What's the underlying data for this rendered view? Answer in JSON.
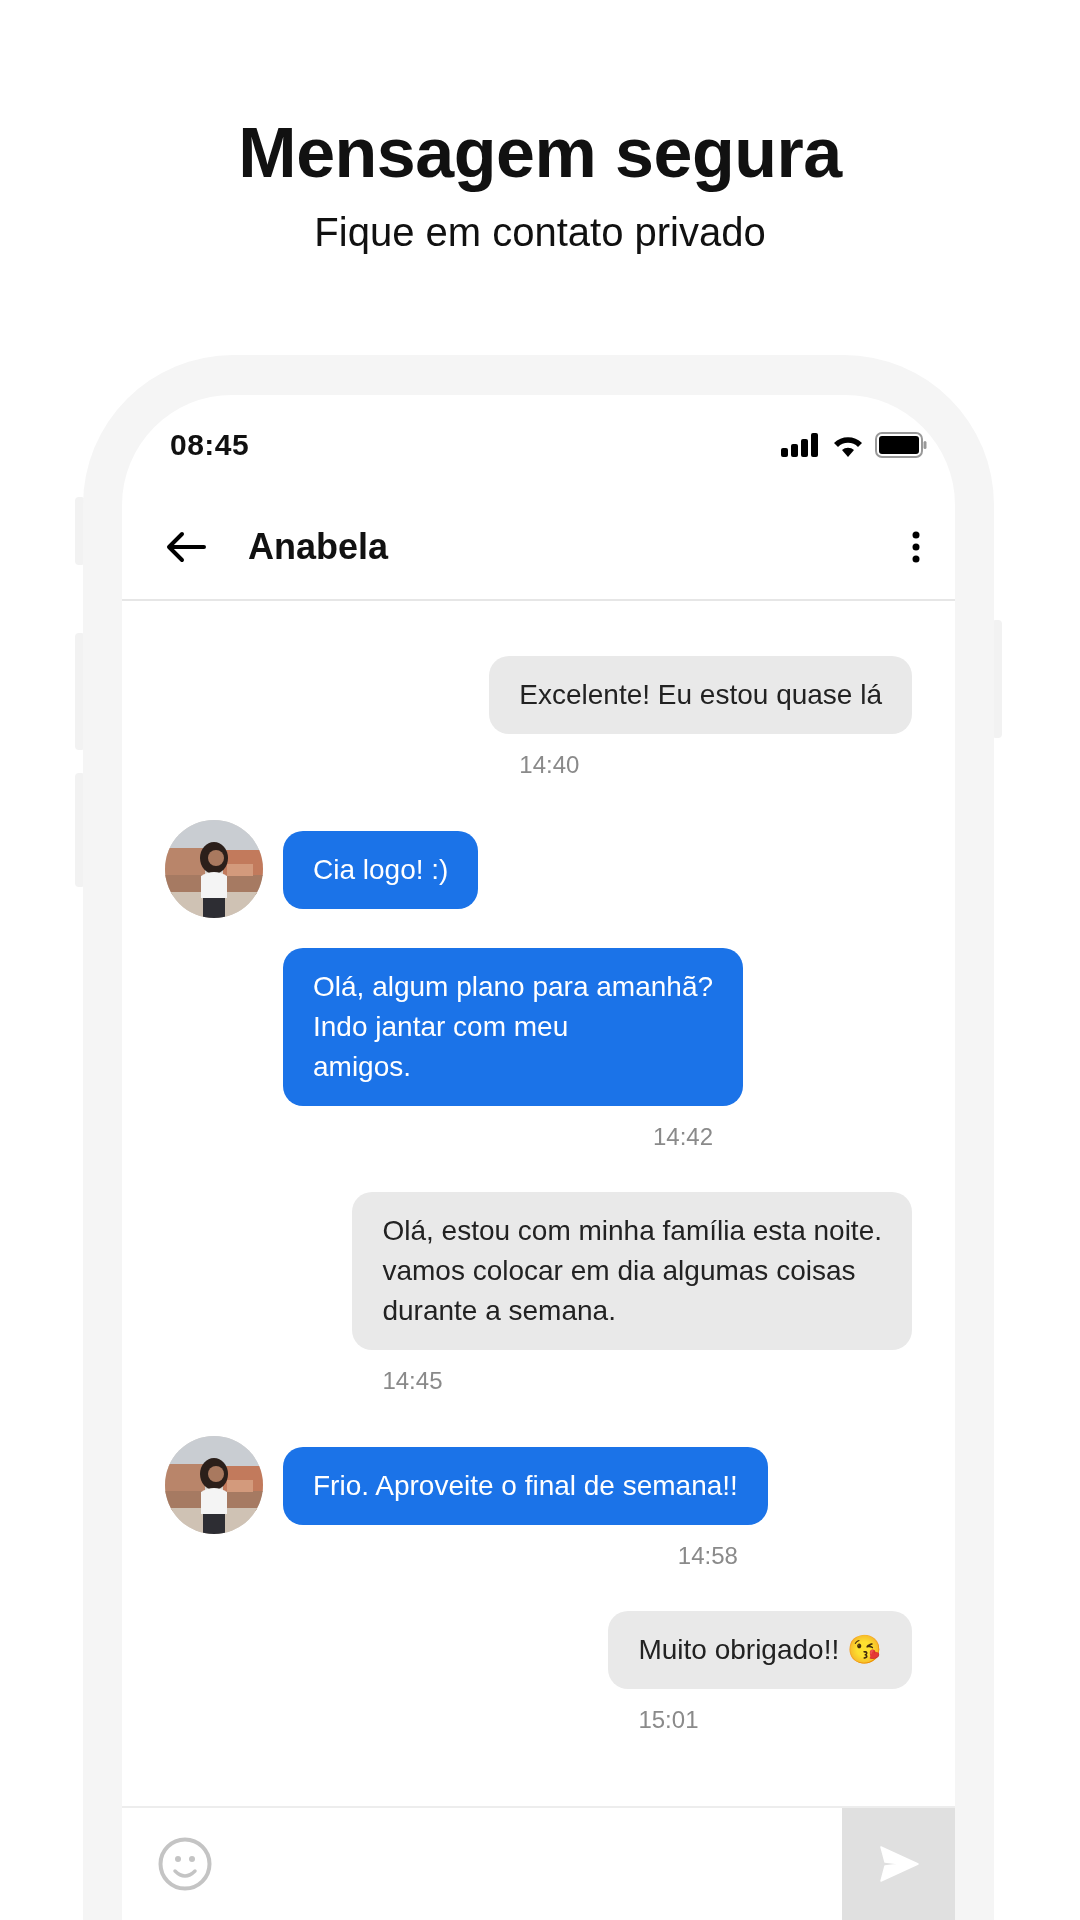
{
  "promo": {
    "title": "Mensagem segura",
    "subtitle": "Fique em contato privado"
  },
  "status_bar": {
    "time": "08:45"
  },
  "chat_header": {
    "contact": "Anabela"
  },
  "messages": [
    {
      "kind": "sent",
      "text": "Excelente! Eu estou quase lá",
      "time": "14:40"
    },
    {
      "kind": "received",
      "avatar": true,
      "text": "Cia logo! :)"
    },
    {
      "kind": "received",
      "avatar": false,
      "text": "Olá, algum plano para amanhã?\nIndo jantar com meu\namigos.",
      "time": "14:42"
    },
    {
      "kind": "sent",
      "text": "Olá, estou com minha família esta noite.\nvamos colocar em dia algumas coisas\ndurante a semana.",
      "time": "14:45"
    },
    {
      "kind": "received",
      "avatar": true,
      "text": "Frio. Aproveite o final de semana!!",
      "time": "14:58"
    },
    {
      "kind": "sent",
      "text": "Muito obrigado!! 😘",
      "time": "15:01"
    }
  ]
}
